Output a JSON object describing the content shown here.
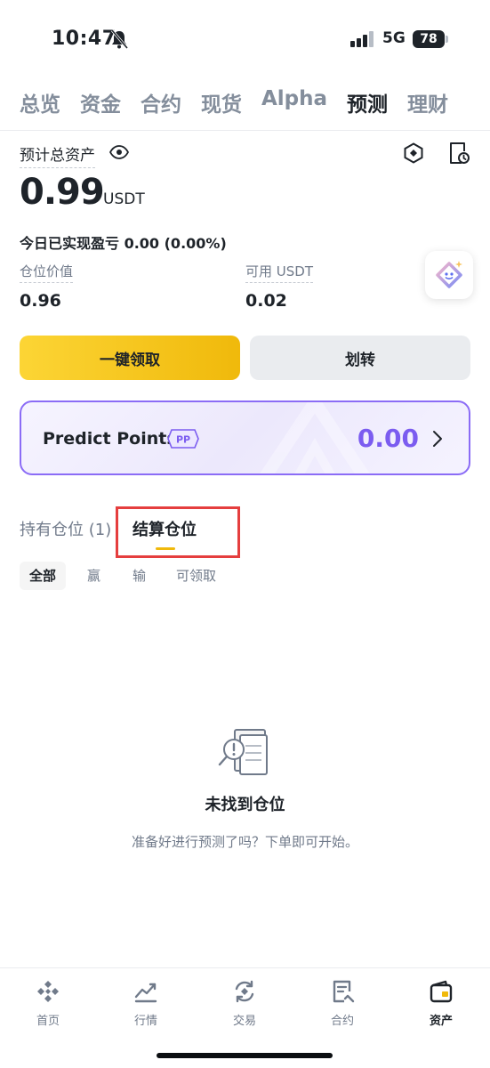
{
  "status_bar": {
    "time": "10:47",
    "network": "5G",
    "battery": "78"
  },
  "top_tabs": [
    {
      "label": "总览",
      "active": false
    },
    {
      "label": "资金",
      "active": false
    },
    {
      "label": "合约",
      "active": false
    },
    {
      "label": "现货",
      "active": false
    },
    {
      "label": "Alpha",
      "active": false
    },
    {
      "label": "预测",
      "active": true
    },
    {
      "label": "理财",
      "active": false
    }
  ],
  "assets": {
    "label": "预计总资产",
    "value": "0.99",
    "unit": "USDT",
    "pnl": "今日已实现盈亏 0.00 (0.00%)",
    "position_value_label": "仓位价值",
    "position_value": "0.96",
    "available_label": "可用 USDT",
    "available_value": "0.02"
  },
  "actions": {
    "claim_label": "一键领取",
    "transfer_label": "划转"
  },
  "points": {
    "title": "Predict Points",
    "badge": "PP",
    "value": "0.00"
  },
  "position_tabs": {
    "holding": "持有仓位 (1)",
    "settled": "结算仓位"
  },
  "filters": [
    "全部",
    "赢",
    "输",
    "可领取"
  ],
  "empty_state": {
    "title": "未找到仓位",
    "description": "准备好进行预测了吗？下单即可开始。"
  },
  "bottom_nav": [
    {
      "label": "首页",
      "icon": "home-icon"
    },
    {
      "label": "行情",
      "icon": "markets-icon"
    },
    {
      "label": "交易",
      "icon": "trade-icon"
    },
    {
      "label": "合约",
      "icon": "futures-icon"
    },
    {
      "label": "资产",
      "icon": "wallet-icon"
    }
  ],
  "colors": {
    "accent": "#f0b90b",
    "points": "#7b5cf0",
    "highlight": "#e53e3e"
  }
}
